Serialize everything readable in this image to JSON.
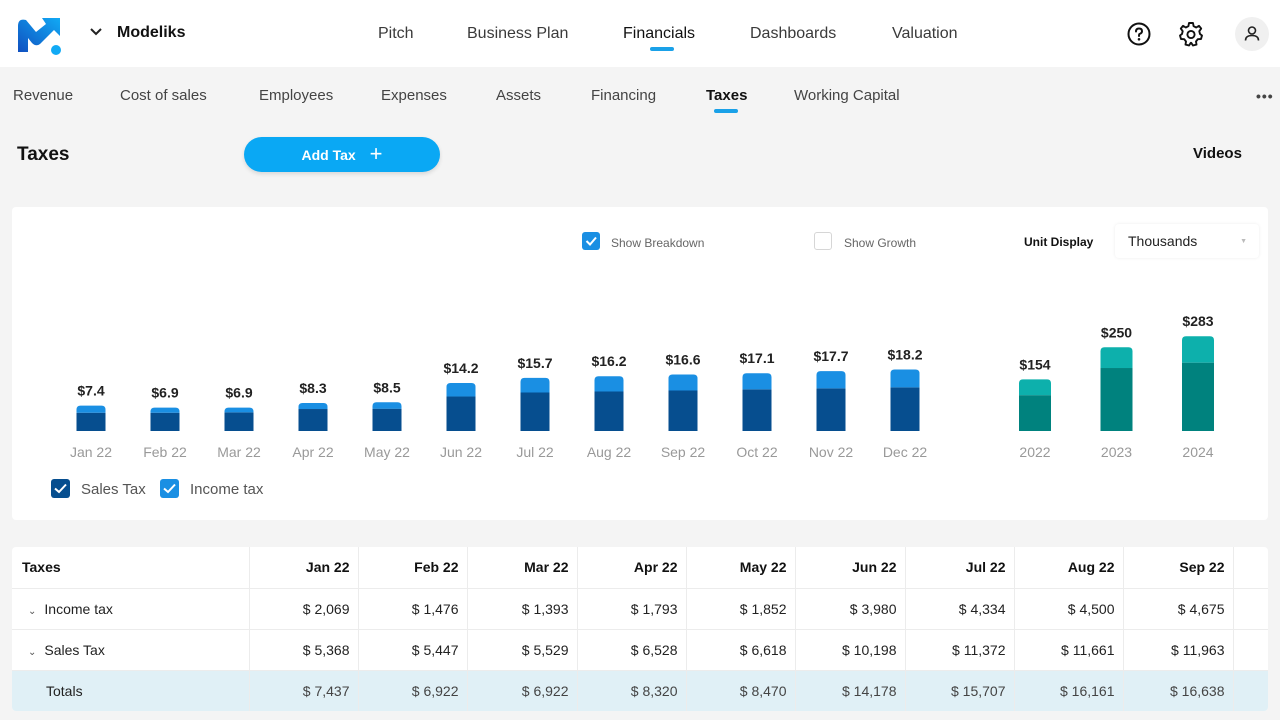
{
  "app": {
    "company_name": "Modeliks",
    "logo_colors": {
      "primary": "#1063c9",
      "accent": "#0aa8f4"
    }
  },
  "main_nav": {
    "items": [
      {
        "label": "Pitch",
        "active": false
      },
      {
        "label": "Business Plan",
        "active": false
      },
      {
        "label": "Financials",
        "active": true
      },
      {
        "label": "Dashboards",
        "active": false
      },
      {
        "label": "Valuation",
        "active": false
      }
    ]
  },
  "header_icons": [
    "help-circle-icon",
    "gear-icon",
    "user-icon"
  ],
  "sub_nav": {
    "items": [
      {
        "label": "Revenue",
        "active": false
      },
      {
        "label": "Cost of sales",
        "active": false
      },
      {
        "label": "Employees",
        "active": false
      },
      {
        "label": "Expenses",
        "active": false
      },
      {
        "label": "Assets",
        "active": false
      },
      {
        "label": "Financing",
        "active": false
      },
      {
        "label": "Taxes",
        "active": true
      },
      {
        "label": "Working Capital",
        "active": false
      }
    ],
    "more_label": "•••"
  },
  "page": {
    "title": "Taxes",
    "add_button_label": "Add Tax",
    "add_button_icon": "+",
    "videos_label": "Videos"
  },
  "chart_controls": {
    "show_breakdown": {
      "label": "Show Breakdown",
      "checked": true
    },
    "show_growth": {
      "label": "Show Growth",
      "checked": false
    },
    "unit_display_label": "Unit Display",
    "unit_display_value": "Thousands"
  },
  "legend": [
    {
      "label": "Sales Tax",
      "checked": true,
      "color": "#064e8f"
    },
    {
      "label": "Income tax",
      "checked": true,
      "color": "#1a8fe3"
    }
  ],
  "chart_data": [
    {
      "type": "bar",
      "stacked": true,
      "title": "",
      "xlabel": "",
      "ylabel": "",
      "units": "Thousands ($)",
      "grid": false,
      "categories": [
        "Jan 22",
        "Feb 22",
        "Mar 22",
        "Apr 22",
        "May 22",
        "Jun 22",
        "Jul 22",
        "Aug 22",
        "Sep 22",
        "Oct 22",
        "Nov 22",
        "Dec 22"
      ],
      "series": [
        {
          "name": "Sales Tax",
          "color": "#064e8f",
          "values": [
            5.4,
            5.4,
            5.5,
            6.5,
            6.6,
            10.2,
            11.4,
            11.7,
            12.0,
            12.3,
            12.6,
            12.9
          ]
        },
        {
          "name": "Income tax",
          "color": "#1a8fe3",
          "values": [
            2.1,
            1.5,
            1.4,
            1.8,
            1.9,
            4.0,
            4.3,
            4.5,
            4.7,
            4.8,
            5.1,
            5.3
          ]
        }
      ],
      "data_labels": [
        "$7.4",
        "$6.9",
        "$6.9",
        "$8.3",
        "$8.5",
        "$14.2",
        "$15.7",
        "$16.2",
        "$16.6",
        "$17.1",
        "$17.7",
        "$18.2"
      ],
      "totals": [
        7.4,
        6.9,
        6.9,
        8.3,
        8.5,
        14.2,
        15.7,
        16.2,
        16.6,
        17.1,
        17.7,
        18.2
      ],
      "ylim": [
        0,
        20
      ]
    },
    {
      "type": "bar",
      "stacked": true,
      "title": "",
      "xlabel": "",
      "ylabel": "",
      "units": "Thousands ($)",
      "grid": false,
      "categories": [
        "2022",
        "2023",
        "2024"
      ],
      "series": [
        {
          "name": "Sales Tax",
          "color": "#00827e",
          "values": [
            107,
            188,
            204
          ]
        },
        {
          "name": "Income tax",
          "color": "#0db0ac",
          "values": [
            47,
            62,
            79
          ]
        }
      ],
      "data_labels": [
        "$154",
        "$250",
        "$283"
      ],
      "totals": [
        154,
        250,
        283
      ],
      "ylim": [
        0,
        300
      ]
    }
  ],
  "table": {
    "header": [
      "Taxes",
      "Jan 22",
      "Feb 22",
      "Mar 22",
      "Apr 22",
      "May 22",
      "Jun 22",
      "Jul 22",
      "Aug 22",
      "Sep 22"
    ],
    "rows": [
      {
        "label": "Income tax",
        "expandable": true,
        "values": [
          "$ 2,069",
          "$ 1,476",
          "$ 1,393",
          "$ 1,793",
          "$ 1,852",
          "$ 3,980",
          "$ 4,334",
          "$ 4,500",
          "$ 4,675"
        ]
      },
      {
        "label": "Sales Tax",
        "expandable": true,
        "values": [
          "$ 5,368",
          "$ 5,447",
          "$ 5,529",
          "$ 6,528",
          "$ 6,618",
          "$ 10,198",
          "$ 11,372",
          "$ 11,661",
          "$ 11,963"
        ]
      },
      {
        "label": "Totals",
        "expandable": false,
        "values": [
          "$ 7,437",
          "$ 6,922",
          "$ 6,922",
          "$ 8,320",
          "$ 8,470",
          "$ 14,178",
          "$ 15,707",
          "$ 16,161",
          "$ 16,638"
        ]
      }
    ]
  }
}
